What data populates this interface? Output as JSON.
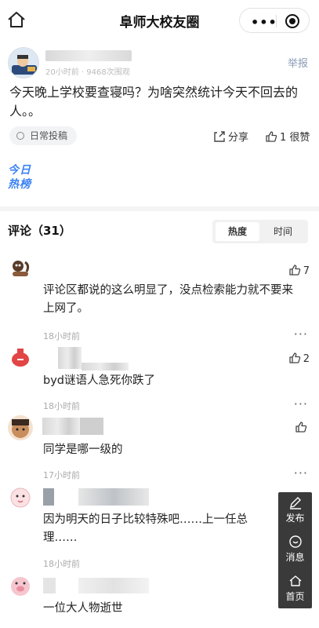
{
  "nav": {
    "title": "阜师大校友圈",
    "more_label": "•••"
  },
  "post": {
    "meta": "20小时前 · 9468次围观",
    "report_label": "举报",
    "text": "今天晚上学校要查寝吗？为啥突然统计今天不回去的人。。",
    "tag": "日常投稿",
    "share_label": "分享",
    "like_label": "1 很赞"
  },
  "hot": {
    "line1": "今日",
    "line2": "热榜"
  },
  "comments_header": {
    "title": "评论（31）",
    "sort_hot": "热度",
    "sort_time": "时间"
  },
  "comments": [
    {
      "text": "评论区都说的这么明显了，没点检索能力就不要来上网了。",
      "time": "18小时前",
      "likes": "7"
    },
    {
      "text": "byd谜语人急死你跌了",
      "time": "18小时前",
      "likes": "2"
    },
    {
      "text": "同学是哪一级的",
      "time": "17小时前",
      "likes": ""
    },
    {
      "text": "因为明天的日子比较特殊吧……上一任总理……",
      "time": "18小时前",
      "likes": ""
    },
    {
      "text": "一位大人物逝世",
      "time": "",
      "likes": ""
    }
  ],
  "float_bar": {
    "publish": "发布",
    "messages": "消息",
    "home": "首页"
  },
  "colors": {
    "accent_blue": "#3b82f6",
    "report_blue": "#8a9bb5",
    "float_bg": "#3a3a3a"
  }
}
